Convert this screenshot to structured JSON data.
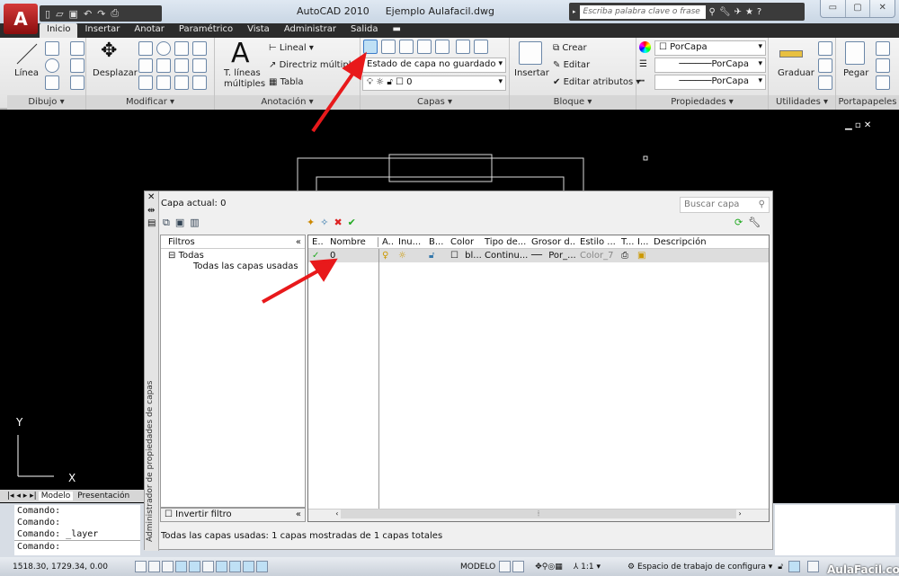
{
  "app": {
    "title": "AutoCAD 2010",
    "file": "Ejemplo Aulafacil.dwg",
    "logo": "A"
  },
  "search": {
    "placeholder": "Escriba palabra clave o frase"
  },
  "window_controls": {
    "minimize": "▭",
    "maximize": "▢",
    "close": "✕"
  },
  "tabs": [
    "Inicio",
    "Insertar",
    "Anotar",
    "Paramétrico",
    "Vista",
    "Administrar",
    "Salida"
  ],
  "ribbon": {
    "dibujo": {
      "title": "Dibujo ▾",
      "linea": "Línea"
    },
    "modificar": {
      "title": "Modificar ▾",
      "desplazar": "Desplazar"
    },
    "anotacion": {
      "title": "Anotación ▾",
      "texto": "T. líneas",
      "texto2": "múltiples",
      "lineal": "Lineal ▾",
      "directriz": "Directriz múltiple",
      "tabla": "Tabla"
    },
    "capas": {
      "title": "Capas ▾",
      "estado": "Estado de capa no guardado",
      "capa": "0"
    },
    "bloque": {
      "title": "Bloque ▾",
      "insertar": "Insertar",
      "crear": "Crear",
      "editar": "Editar",
      "editar_atributos": "Editar atributos ▾"
    },
    "propiedades": {
      "title": "Propiedades ▾",
      "color": "PorCapa",
      "tipo_linea": "PorCapa",
      "grosor": "PorCapa"
    },
    "utilidades": {
      "title": "Utilidades ▾",
      "graduar": "Graduar"
    },
    "portapapeles": {
      "title": "Portapapeles",
      "pegar": "Pegar"
    }
  },
  "layer_manager": {
    "side_title": "Administrador de propiedades de capas",
    "current_layer": "Capa actual: 0",
    "search_placeholder": "Buscar capa",
    "filters_title": "Filtros",
    "tree": [
      "Todas",
      "Todas las capas usadas"
    ],
    "invert_filter": "Invertir filtro",
    "columns": [
      "E..",
      "Nombre",
      "A..",
      "Inu...",
      "B...",
      "Color",
      "Tipo de...",
      "Grosor d...",
      "Estilo ...",
      "T...",
      "I...",
      "Descripción"
    ],
    "rows": [
      {
        "estado": "✓",
        "nombre": "0",
        "color": "bl...",
        "tipo": "Continu...",
        "grosor": "Por_...",
        "estilo": "Color_7"
      }
    ],
    "status": "Todas las capas usadas: 1 capas mostradas de 1 capas totales"
  },
  "layout_tabs": [
    "Modelo",
    "Presentación"
  ],
  "command_lines": [
    "Comando:",
    "Comando:",
    "Comando:  _layer",
    "Comando:"
  ],
  "status_bar": {
    "coords": "1518.30, 1729.34, 0.00",
    "modelo": "MODELO",
    "scale": "1:1 ▾",
    "workspace": "Espacio de trabajo de configura ▾"
  },
  "watermark": "AulaFacil.com",
  "colors": {
    "arrow": "#e8191b",
    "accent": "#1c6fb8"
  }
}
